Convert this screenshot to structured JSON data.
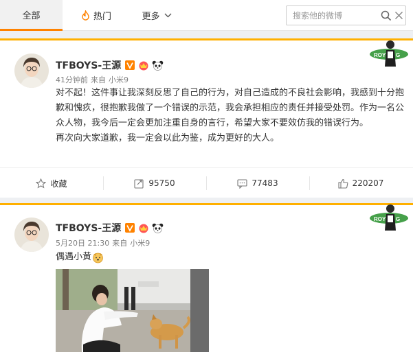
{
  "filter_bar": {
    "tabs": [
      {
        "label": "全部",
        "active": true
      },
      {
        "label": "热门"
      },
      {
        "label": "更多"
      }
    ],
    "search": {
      "placeholder": "搜索他的微博"
    }
  },
  "posts": [
    {
      "author": "TFBOYS-王源",
      "time": "41分钟前",
      "source_prefix": "来自",
      "source": "小米9",
      "paragraphs": [
        "对不起！这件事让我深刻反思了自己的行为，对自己造成的不良社会影响，我感到十分抱歉和愧疚，很抱歉我做了一个错误的示范，我会承担相应的责任并接受处罚。作为一名公众人物，我今后一定会更加注重自身的言行，希望大家不要效仿我的错误行为。",
        "再次向大家道歉，我一定会以此为鉴，成为更好的大人。"
      ],
      "actions": {
        "favorite_label": "收藏",
        "repost_count": "95750",
        "comment_count": "77483",
        "like_count": "220207"
      }
    },
    {
      "author": "TFBOYS-王源",
      "time": "5月20日 21:30",
      "source_prefix": "来自",
      "source": "小米9",
      "text": "偶遇小黄"
    }
  ],
  "icons": {
    "hot": "flame-icon",
    "more": "chevron-down-icon",
    "search": "search-icon",
    "clear": "close-icon",
    "verified": "orange-v-verified-icon",
    "favorite": "star-icon",
    "repost": "repost-icon",
    "comment": "comment-icon",
    "like": "thumb-up-icon"
  },
  "colors": {
    "accent": "#ff8200",
    "card_top_border": "#ffb000",
    "page_bg": "#eef0f3"
  }
}
